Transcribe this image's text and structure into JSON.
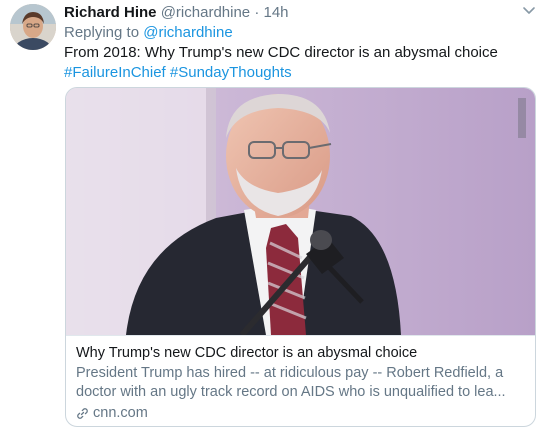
{
  "tweet": {
    "display_name": "Richard Hine",
    "handle": "@richardhine",
    "separator": "·",
    "time": "14h",
    "reply_prefix": "Replying to",
    "reply_mention": "@richardhine",
    "text": "From 2018: Why Trump's new CDC director is an abysmal choice",
    "hashtags": "#FailureInChief #SundayThoughts",
    "avatar_icon": "user-avatar",
    "menu_icon": "chevron-down-icon"
  },
  "card": {
    "title": "Why Trump's new CDC director is an abysmal choice",
    "description": "President Trump has hired -- at ridiculous pay -- Robert Redfield, a doctor with an ugly track record on AIDS who is unqualified to lea...",
    "domain": "cnn.com",
    "link_icon": "link-icon"
  },
  "colors": {
    "link": "#1b95e0",
    "secondary_text": "#657786",
    "primary_text": "#14171a",
    "border": "#ccd6dd"
  }
}
